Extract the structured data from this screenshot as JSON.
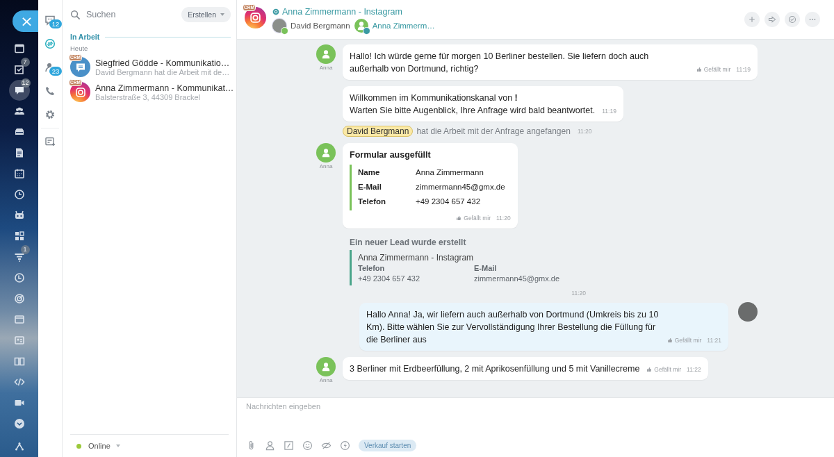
{
  "left_nav": {
    "close": "×",
    "items": [
      {
        "selected": false
      },
      {
        "selected": false,
        "badge": "7"
      },
      {
        "selected": true,
        "badge": "12"
      },
      {
        "selected": false
      },
      {
        "selected": false
      },
      {
        "selected": false
      },
      {
        "selected": false
      },
      {
        "selected": false
      },
      {
        "selected": false
      },
      {
        "selected": false
      },
      {
        "selected": false,
        "badge": "1"
      },
      {
        "selected": false
      },
      {
        "selected": false
      },
      {
        "selected": false
      },
      {
        "selected": false
      },
      {
        "selected": false
      },
      {
        "selected": false
      },
      {
        "selected": false
      },
      {
        "selected": false
      },
      {
        "selected": false
      }
    ]
  },
  "messenger_nav": {
    "items": [
      {
        "selected": false,
        "badge": "12"
      },
      {
        "selected": true
      },
      {
        "selected": false,
        "badge": "23"
      },
      {
        "selected": false
      },
      {
        "selected": false
      },
      {
        "selected": false
      }
    ]
  },
  "chat_list": {
    "search": {
      "placeholder": "Suchen"
    },
    "create_button": "Erstellen",
    "section": "In Arbeit",
    "date": "Heute",
    "chats": [
      {
        "kind": "livechat",
        "tag": "CRM",
        "title": "Siegfried Gödde - Kommunikatio…",
        "subtitle": "David Bergmann hat die Arbeit mit de…"
      },
      {
        "kind": "instagram",
        "tag": "CRM",
        "title": "Anna Zimmermann - Kommunikat…",
        "subtitle": "Balsterstraße 3, 44309 Brackel"
      }
    ],
    "status": "Online"
  },
  "chat": {
    "header": {
      "tag": "CRM",
      "title": "Anna Zimmermann - Instagram",
      "participants": [
        {
          "kind": "operator",
          "name": "David Bergmann"
        },
        {
          "kind": "client",
          "name": "Anna Zimmerm…"
        }
      ]
    },
    "messages": [
      {
        "kind": "incoming",
        "author": "Anna",
        "text": "Hallo! Ich würde gerne für morgen 10 Berliner bestellen. Sie liefern doch auch außerhalb von Dortmund, richtig?",
        "like": "Gefällt mir",
        "time": "11:19"
      },
      {
        "kind": "system",
        "text": "Willkommen im Kommunikationskanal von **!**",
        "text_2": "Warten Sie bitte Augenblick, Ihre Anfrage wird bald beantwortet.",
        "time": "11:19"
      },
      {
        "kind": "event",
        "user": "David Bergmann",
        "text": "hat die Arbeit mit der Anfrage angefangen",
        "time": "11:20"
      },
      {
        "kind": "form",
        "author": "Anna",
        "title": "Formular ausgefüllt",
        "fields": [
          {
            "label": "Name",
            "value": "Anna Zimmermann"
          },
          {
            "label": "E-Mail",
            "value": "zimmermann45@gmx.de"
          },
          {
            "label": "Telefon",
            "value": "+49 2304 657 432"
          }
        ],
        "like": "Gefällt mir",
        "time": "11:20"
      },
      {
        "kind": "lead",
        "title": "Ein neuer Lead wurde erstellt",
        "name": "Anna Zimmermann - Instagram",
        "fields": [
          {
            "label": "Telefon",
            "value": "+49 2304 657 432"
          },
          {
            "label": "E-Mail",
            "value": "zimmermann45@gmx.de"
          }
        ],
        "time": "11:20"
      },
      {
        "kind": "outgoing",
        "text": "Hallo Anna! Ja, wir liefern auch außerhalb von Dortmund (Umkreis bis zu 10 Km). Bitte wählen Sie zur Vervollständigung Ihrer Bestellung die Füllung für die Berliner aus",
        "like": "Gefällt mir",
        "time": "11:21"
      },
      {
        "kind": "incoming",
        "author": "Anna",
        "text": "3 Berliner mit Erdbeerfüllung, 2 mit Aprikosenfüllung und 5 mit Vanillecreme",
        "like": "Gefällt mir",
        "time": "11:22"
      }
    ],
    "composer": {
      "placeholder": "Nachrichten eingeben",
      "sale_button": "Verkauf starten"
    }
  }
}
